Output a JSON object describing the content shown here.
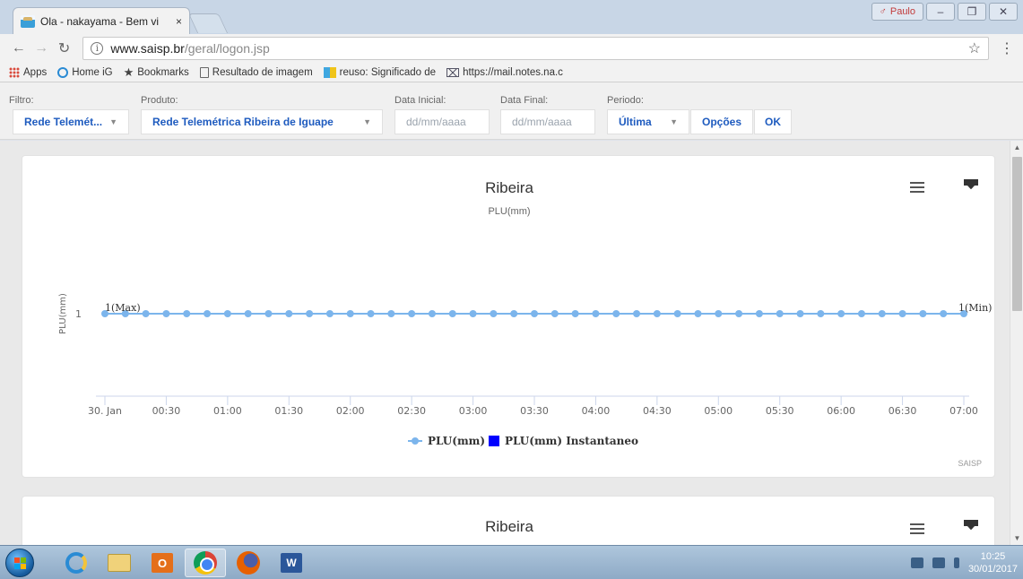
{
  "browser": {
    "tab_title": "Ola - nakayama - Bem vi",
    "tab_close": "×",
    "user_name": "Paulo",
    "url_host": "www.saisp.br",
    "url_path": "/geral/logon.jsp",
    "bookmarks": [
      {
        "label": "Apps",
        "icon": "apps-grid-icon"
      },
      {
        "label": "Home iG",
        "icon": "ig-icon"
      },
      {
        "label": "Bookmarks",
        "icon": "star-icon"
      },
      {
        "label": "Resultado de imagem",
        "icon": "page-icon"
      },
      {
        "label": "reuso: Significado de",
        "icon": "dictionary-icon"
      },
      {
        "label": "https://mail.notes.na.c",
        "icon": "mail-icon"
      }
    ]
  },
  "filters": {
    "filtro_label": "Filtro:",
    "filtro_value": "Rede Telemét...",
    "produto_label": "Produto:",
    "produto_value": "Rede Telemétrica Ribeira de Iguape",
    "data_inicial_label": "Data Inicial:",
    "data_inicial_placeholder": "dd/mm/aaaa",
    "data_final_label": "Data Final:",
    "data_final_placeholder": "dd/mm/aaaa",
    "periodo_label": "Periodo:",
    "periodo_value": "Última",
    "opcoes_label": "Opções",
    "ok_label": "OK"
  },
  "chart1": {
    "title": "Ribeira",
    "credits": "SAISP"
  },
  "chart2": {
    "title": "Ribeira"
  },
  "chart_data": {
    "type": "line",
    "title": "Ribeira",
    "subtitle": "PLU(mm)",
    "ylabel": "PLU(mm)",
    "xlabel": "",
    "y_ticks": [
      "1"
    ],
    "x_ticks": [
      "30. Jan",
      "00:30",
      "01:00",
      "01:30",
      "02:00",
      "02:30",
      "03:00",
      "03:30",
      "04:00",
      "04:30",
      "05:00",
      "05:30",
      "06:00",
      "06:30",
      "07:00"
    ],
    "x_start_min": 0,
    "x_end_min": 420,
    "point_interval_min": 10,
    "series": [
      {
        "name": "PLU(mm)",
        "color": "#7cb5ec",
        "y": 1,
        "count": 43
      },
      {
        "name": "PLU(mm) Instantaneo",
        "color": "#0000ff",
        "values": []
      }
    ],
    "annotations": [
      {
        "text": "1(Max)",
        "at_min": 0,
        "value": 1
      },
      {
        "text": "1(Min)",
        "at_min": 420,
        "value": 1
      }
    ],
    "legend": "bottom-center",
    "grid": false
  },
  "taskbar": {
    "time": "10:25",
    "date": "30/01/2017",
    "apps": [
      "internet-explorer",
      "file-explorer",
      "outlook",
      "chrome",
      "firefox",
      "word"
    ]
  }
}
